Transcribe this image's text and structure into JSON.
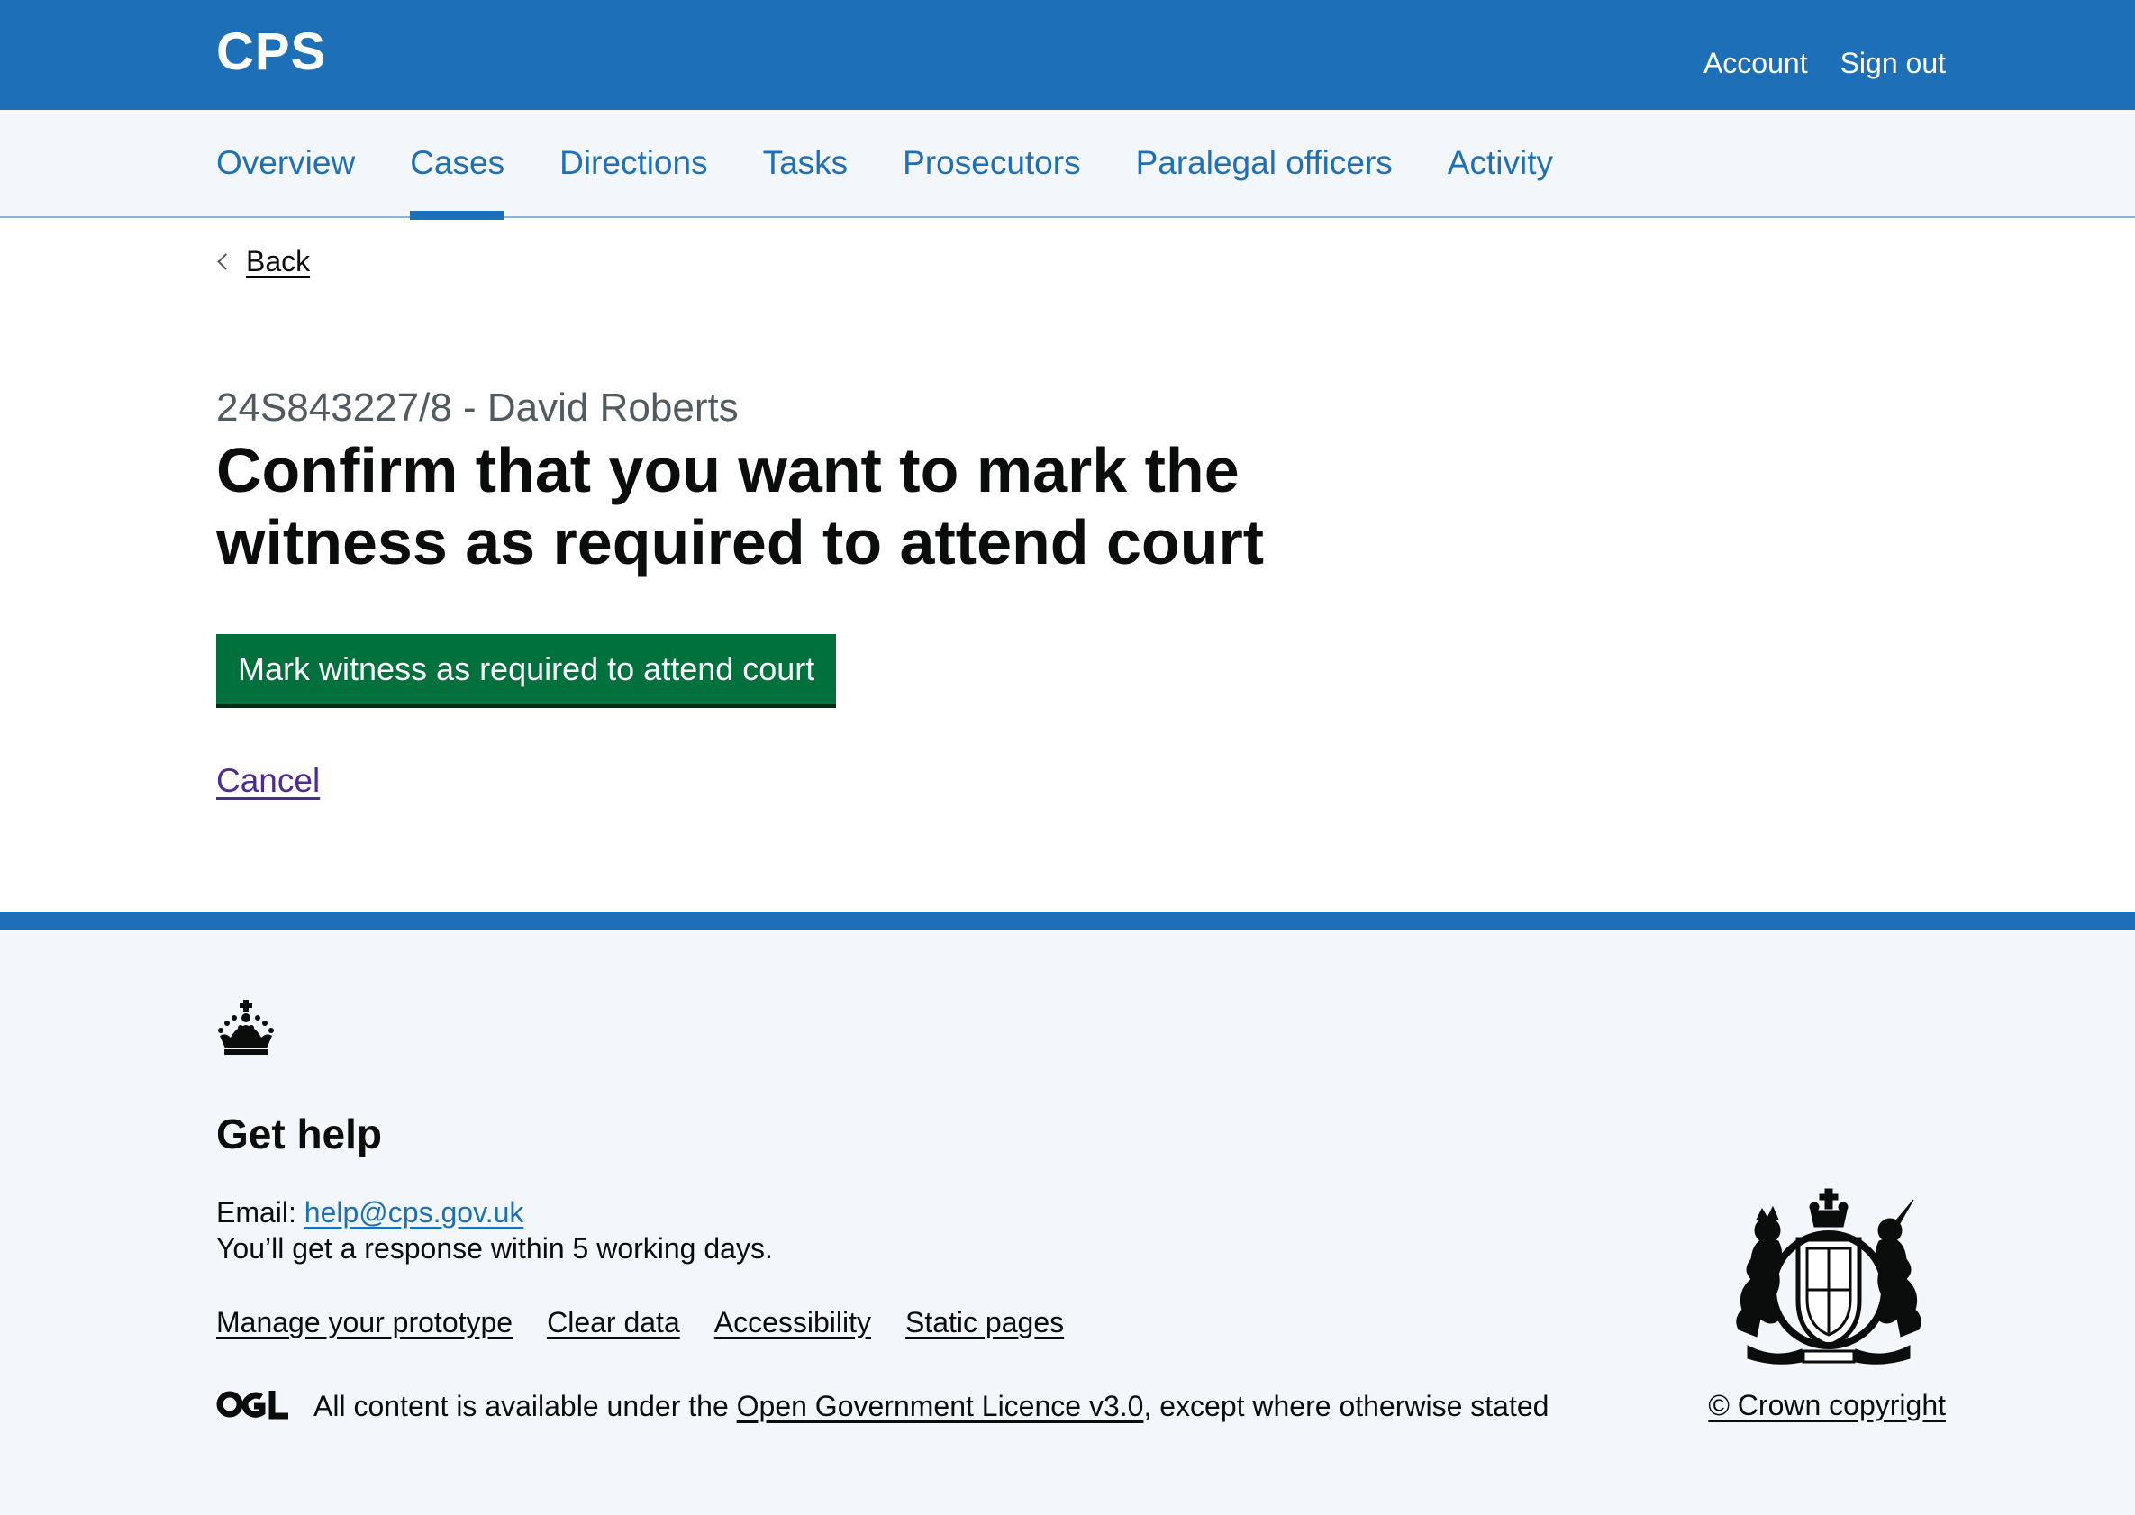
{
  "header": {
    "logo": "CPS",
    "account_link": "Account",
    "signout_link": "Sign out"
  },
  "nav": {
    "items": [
      {
        "label": "Overview",
        "active": false
      },
      {
        "label": "Cases",
        "active": true
      },
      {
        "label": "Directions",
        "active": false
      },
      {
        "label": "Tasks",
        "active": false
      },
      {
        "label": "Prosecutors",
        "active": false
      },
      {
        "label": "Paralegal officers",
        "active": false
      },
      {
        "label": "Activity",
        "active": false
      }
    ]
  },
  "main": {
    "back_link": "Back",
    "caption": "24S843227/8 - David Roberts",
    "heading": "Confirm that you want to mark the witness as required to attend court",
    "primary_button": "Mark witness as required to attend court",
    "cancel_link": "Cancel"
  },
  "footer": {
    "get_help_title": "Get help",
    "email_label": "Email: ",
    "email_link": "help@cps.gov.uk",
    "response_text": "You’ll get a response within 5 working days.",
    "links": [
      "Manage your prototype",
      "Clear data",
      "Accessibility",
      "Static pages"
    ],
    "ogl_logo": "OGL",
    "licence_prefix": "All content is available under the ",
    "licence_link": "Open Government Licence v3.0",
    "licence_suffix": ", except where otherwise stated",
    "copyright": "© Crown copyright"
  },
  "colors": {
    "brand_blue": "#1d70b8",
    "button_green": "#00703c",
    "visited_purple": "#4c2c92",
    "nav_bg": "#f3f7fb"
  }
}
